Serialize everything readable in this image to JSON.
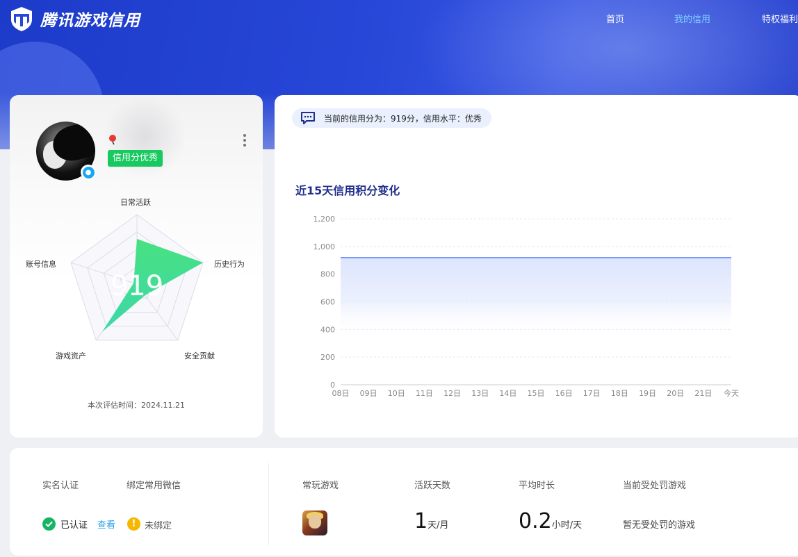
{
  "header": {
    "brand": "腾讯游戏信用",
    "nav": [
      {
        "label": "首页",
        "active": false
      },
      {
        "label": "我的信用",
        "active": true
      },
      {
        "label": "特权福利",
        "active": false
      }
    ]
  },
  "profile": {
    "badge": "信用分优秀",
    "score": "919",
    "radar": {
      "axes": [
        "日常活跃",
        "历史行为",
        "安全贡献",
        "游戏资产",
        "账号信息"
      ],
      "values": [
        0.65,
        1.0,
        0.2,
        0.85,
        0.05
      ],
      "max": 1.0
    },
    "eval_time": "本次评估时间：2024.11.21"
  },
  "credit_summary": "当前的信用分为：919分，信用水平：优秀",
  "chart": {
    "title": "近15天信用积分变化"
  },
  "chart_data": {
    "type": "area",
    "title": "近15天信用积分变化",
    "x": [
      "08日",
      "09日",
      "10日",
      "11日",
      "12日",
      "13日",
      "14日",
      "15日",
      "16日",
      "17日",
      "18日",
      "19日",
      "20日",
      "21日",
      "今天"
    ],
    "series": [
      {
        "values": [
          919,
          919,
          919,
          919,
          919,
          919,
          919,
          919,
          919,
          919,
          919,
          919,
          919,
          919,
          919
        ]
      }
    ],
    "ylim": [
      0,
      1200
    ],
    "yticks": [
      0,
      200,
      400,
      600,
      800,
      1000,
      1200
    ],
    "ytick_labels": [
      "0",
      "200",
      "400",
      "600",
      "800",
      "1,000",
      "1,200"
    ],
    "grid": true,
    "line_color": "#7b97f5",
    "fill_color": "#dde5fd"
  },
  "account": {
    "realname_label": "实名认证",
    "realname_value": "已认证",
    "realname_link": "查看",
    "wechat_label": "绑定常用微信",
    "wechat_value": "未绑定"
  },
  "stats": {
    "games_label": "常玩游戏",
    "active_label": "活跃天数",
    "active_value": "1",
    "active_unit": "天/月",
    "avg_label": "平均时长",
    "avg_value": "0.2",
    "avg_unit": "小时/天",
    "penalty_label": "当前受处罚游戏",
    "penalty_value": "暂无受处罚的游戏"
  },
  "colors": {
    "brand_blue": "#2747d8",
    "nav_active": "#7fd3ff",
    "badge_green": "#18c95f",
    "radar_green": "#2ed98a",
    "link": "#2aa3e8",
    "ok": "#16b464",
    "warn": "#f5b800"
  }
}
